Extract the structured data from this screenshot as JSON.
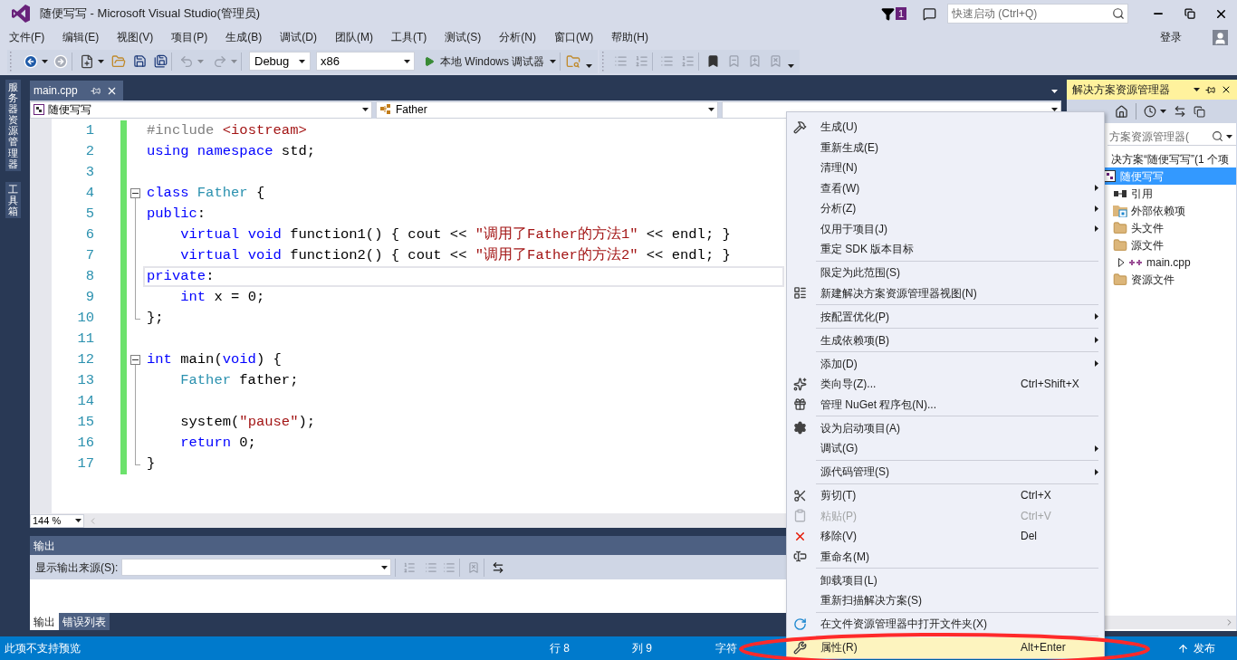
{
  "window": {
    "title": "随便写写 - Microsoft Visual Studio(管理员)",
    "notification_count": "1",
    "quick_launch": {
      "placeholder": "快速启动 (Ctrl+Q)"
    }
  },
  "menu_bar": {
    "items": [
      "文件(F)",
      "编辑(E)",
      "视图(V)",
      "项目(P)",
      "生成(B)",
      "调试(D)",
      "团队(M)",
      "工具(T)",
      "测试(S)",
      "分析(N)",
      "窗口(W)",
      "帮助(H)"
    ],
    "sign_in": "登录"
  },
  "toolbar": {
    "configuration": "Debug",
    "platform": "x86",
    "debug_target": "本地 Windows 调试器"
  },
  "side_tabs": [
    "服务器资源管理器",
    "工具箱"
  ],
  "editor": {
    "tabs": [
      {
        "label": "main.cpp",
        "selected": true
      }
    ],
    "nav": {
      "project": "随便写写",
      "scope": "Father"
    },
    "zoom": "144 %",
    "lines": [
      {
        "number": "1",
        "kind": "plain",
        "changed": true,
        "current": false,
        "tokens": [
          {
            "kind": "preproc",
            "text": "#include"
          },
          {
            "kind": "string",
            "text": " <iostream>"
          }
        ]
      },
      {
        "number": "2",
        "kind": "plain",
        "changed": true,
        "current": false,
        "tokens": [
          {
            "kind": "keyword",
            "text": "using"
          },
          {
            "kind": "keyword",
            "text": " namespace"
          },
          {
            "kind": "text",
            "text": " std;"
          }
        ]
      },
      {
        "number": "3",
        "kind": "plain",
        "changed": true,
        "current": false
      },
      {
        "number": "4",
        "kind": "fold-start",
        "changed": true,
        "current": false,
        "tokens": [
          {
            "kind": "keyword",
            "text": "class"
          },
          {
            "kind": "type",
            "text": " Father"
          },
          {
            "kind": "text",
            "text": " {"
          }
        ]
      },
      {
        "number": "5",
        "kind": "fold-body",
        "changed": true,
        "current": false,
        "tokens": [
          {
            "kind": "keyword",
            "text": "public"
          },
          {
            "kind": "text",
            "text": ":"
          }
        ]
      },
      {
        "number": "6",
        "kind": "fold-body",
        "changed": true,
        "current": false,
        "tokens": [
          {
            "kind": "keyword",
            "text": "    virtual"
          },
          {
            "kind": "keyword",
            "text": " void"
          },
          {
            "kind": "text",
            "text": " function1() { cout << "
          },
          {
            "kind": "string",
            "text": "\"调用了Father的方法1\""
          },
          {
            "kind": "text",
            "text": " << endl; }"
          }
        ]
      },
      {
        "number": "7",
        "kind": "fold-body",
        "changed": true,
        "current": false,
        "tokens": [
          {
            "kind": "keyword",
            "text": "    virtual"
          },
          {
            "kind": "keyword",
            "text": " void"
          },
          {
            "kind": "text",
            "text": " function2() { cout << "
          },
          {
            "kind": "string",
            "text": "\"调用了Father的方法2\""
          },
          {
            "kind": "text",
            "text": " << endl; }"
          }
        ]
      },
      {
        "number": "8",
        "kind": "fold-body",
        "changed": true,
        "current": true,
        "tokens": [
          {
            "kind": "keyword",
            "text": "private"
          },
          {
            "kind": "text",
            "text": ":"
          }
        ]
      },
      {
        "number": "9",
        "kind": "fold-body",
        "changed": true,
        "current": false,
        "tokens": [
          {
            "kind": "keyword",
            "text": "    int"
          },
          {
            "kind": "text",
            "text": " x = 0;"
          }
        ]
      },
      {
        "number": "10",
        "kind": "fold-end",
        "changed": true,
        "current": false,
        "tokens": [
          {
            "kind": "text",
            "text": "};"
          }
        ]
      },
      {
        "number": "11",
        "kind": "plain",
        "changed": true,
        "current": false
      },
      {
        "number": "12",
        "kind": "fold-start",
        "changed": true,
        "current": false,
        "tokens": [
          {
            "kind": "keyword",
            "text": "int"
          },
          {
            "kind": "text",
            "text": " main("
          },
          {
            "kind": "keyword",
            "text": "void"
          },
          {
            "kind": "text",
            "text": ") {"
          }
        ]
      },
      {
        "number": "13",
        "kind": "fold-body",
        "changed": true,
        "current": false,
        "tokens": [
          {
            "kind": "type",
            "text": "    Father"
          },
          {
            "kind": "text",
            "text": " father;"
          }
        ]
      },
      {
        "number": "14",
        "kind": "fold-body",
        "changed": true,
        "current": false
      },
      {
        "number": "15",
        "kind": "fold-body",
        "changed": true,
        "current": false,
        "tokens": [
          {
            "kind": "text",
            "text": "    system("
          },
          {
            "kind": "string",
            "text": "\"pause\""
          },
          {
            "kind": "text",
            "text": ");"
          }
        ]
      },
      {
        "number": "16",
        "kind": "fold-body",
        "changed": true,
        "current": false,
        "tokens": [
          {
            "kind": "keyword",
            "text": "    return"
          },
          {
            "kind": "text",
            "text": " 0;"
          }
        ]
      },
      {
        "number": "17",
        "kind": "fold-end",
        "changed": true,
        "current": false,
        "tokens": [
          {
            "kind": "text",
            "text": "}"
          }
        ]
      }
    ]
  },
  "output": {
    "title": "输出",
    "source_label": "显示输出来源(S):",
    "tabs": [
      {
        "label": "输出",
        "selected": true
      },
      {
        "label": "错误列表",
        "selected": false
      }
    ]
  },
  "solution_explorer": {
    "title": "解决方案资源管理器",
    "search_placeholder": "方案资源管理器(",
    "tree": {
      "label": "决方案“随便写写”(1 个项",
      "selected": false,
      "children": [
        {
          "label": "随便写写",
          "kind": "project",
          "selected": true,
          "children": [
            {
              "label": "引用",
              "kind": "references",
              "selected": false
            },
            {
              "label": "外部依赖项",
              "kind": "external",
              "selected": false
            },
            {
              "label": "头文件",
              "kind": "folder",
              "selected": false
            },
            {
              "label": "源文件",
              "kind": "folder",
              "selected": false,
              "children": [
                {
                  "label": "main.cpp",
                  "kind": "file",
                  "selected": false,
                  "expanded": false
                }
              ]
            },
            {
              "label": "资源文件",
              "kind": "folder",
              "selected": false
            }
          ]
        }
      ]
    }
  },
  "context_menu": {
    "items": [
      {
        "kind": "item",
        "label": "生成(U)",
        "submenu": false,
        "disabled": false,
        "selected": false
      },
      {
        "kind": "item",
        "label": "重新生成(E)",
        "submenu": false,
        "disabled": false,
        "selected": false
      },
      {
        "kind": "item",
        "label": "清理(N)",
        "submenu": false,
        "disabled": false,
        "selected": false
      },
      {
        "kind": "item",
        "label": "查看(W)",
        "submenu": true,
        "disabled": false,
        "selected": false
      },
      {
        "kind": "item",
        "label": "分析(Z)",
        "submenu": true,
        "disabled": false,
        "selected": false
      },
      {
        "kind": "item",
        "label": "仅用于项目(J)",
        "submenu": true,
        "disabled": false,
        "selected": false
      },
      {
        "kind": "item",
        "label": "重定 SDK 版本目标",
        "submenu": false,
        "disabled": false,
        "selected": false
      },
      {
        "kind": "separator"
      },
      {
        "kind": "item",
        "label": "限定为此范围(S)",
        "submenu": false,
        "disabled": false,
        "selected": false
      },
      {
        "kind": "item",
        "label": "新建解决方案资源管理器视图(N)",
        "submenu": false,
        "disabled": false,
        "selected": false
      },
      {
        "kind": "separator"
      },
      {
        "kind": "item",
        "label": "按配置优化(P)",
        "submenu": true,
        "disabled": false,
        "selected": false
      },
      {
        "kind": "separator"
      },
      {
        "kind": "item",
        "label": "生成依赖项(B)",
        "submenu": true,
        "disabled": false,
        "selected": false
      },
      {
        "kind": "separator"
      },
      {
        "kind": "item",
        "label": "添加(D)",
        "submenu": true,
        "disabled": false,
        "selected": false
      },
      {
        "kind": "item",
        "label": "类向导(Z)...",
        "shortcut": "Ctrl+Shift+X",
        "submenu": false,
        "disabled": false,
        "selected": false
      },
      {
        "kind": "item",
        "label": "管理 NuGet 程序包(N)...",
        "submenu": false,
        "disabled": false,
        "selected": false
      },
      {
        "kind": "separator"
      },
      {
        "kind": "item",
        "label": "设为启动项目(A)",
        "submenu": false,
        "disabled": false,
        "selected": false
      },
      {
        "kind": "item",
        "label": "调试(G)",
        "submenu": true,
        "disabled": false,
        "selected": false
      },
      {
        "kind": "separator"
      },
      {
        "kind": "item",
        "label": "源代码管理(S)",
        "submenu": true,
        "disabled": false,
        "selected": false
      },
      {
        "kind": "separator"
      },
      {
        "kind": "item",
        "label": "剪切(T)",
        "shortcut": "Ctrl+X",
        "submenu": false,
        "disabled": false,
        "selected": false
      },
      {
        "kind": "item",
        "label": "粘贴(P)",
        "shortcut": "Ctrl+V",
        "submenu": false,
        "disabled": true,
        "selected": false
      },
      {
        "kind": "item",
        "label": "移除(V)",
        "shortcut": "Del",
        "submenu": false,
        "disabled": false,
        "selected": false
      },
      {
        "kind": "item",
        "label": "重命名(M)",
        "submenu": false,
        "disabled": false,
        "selected": false
      },
      {
        "kind": "separator"
      },
      {
        "kind": "item",
        "label": "卸载项目(L)",
        "submenu": false,
        "disabled": false,
        "selected": false
      },
      {
        "kind": "item",
        "label": "重新扫描解决方案(S)",
        "submenu": false,
        "disabled": false,
        "selected": false
      },
      {
        "kind": "separator"
      },
      {
        "kind": "item",
        "label": "在文件资源管理器中打开文件夹(X)",
        "submenu": false,
        "disabled": false,
        "selected": false
      },
      {
        "kind": "separator"
      },
      {
        "kind": "item",
        "label": "属性(R)",
        "shortcut": "Alt+Enter",
        "submenu": false,
        "disabled": false,
        "selected": true
      }
    ]
  },
  "status_bar": {
    "message": "此项不支持预览",
    "line": "行 8",
    "column": "列 9",
    "char": "字符",
    "publish": "发布"
  }
}
